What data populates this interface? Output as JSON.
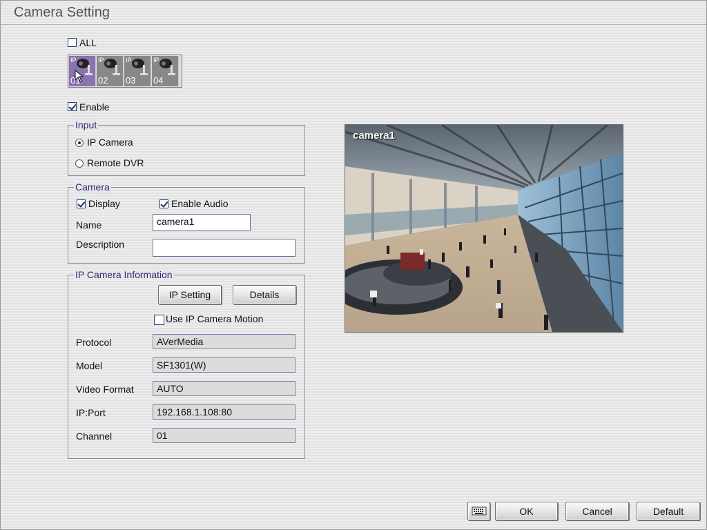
{
  "window": {
    "title": "Camera Setting"
  },
  "selector": {
    "all_label": "ALL",
    "all_checked": false,
    "cameras": [
      {
        "tag": "IP",
        "number": "01",
        "selected": true
      },
      {
        "tag": "IP",
        "number": "02",
        "selected": false
      },
      {
        "tag": "IP",
        "number": "03",
        "selected": false
      },
      {
        "tag": "IP",
        "number": "04",
        "selected": false
      }
    ]
  },
  "enable": {
    "label": "Enable",
    "checked": true
  },
  "input_group": {
    "title": "Input",
    "options": [
      {
        "label": "IP Camera",
        "selected": true
      },
      {
        "label": "Remote DVR",
        "selected": false
      }
    ]
  },
  "camera_group": {
    "title": "Camera",
    "display_label": "Display",
    "display_checked": true,
    "audio_label": "Enable Audio",
    "audio_checked": true,
    "name_label": "Name",
    "name_value": "camera1",
    "description_label": "Description",
    "description_value": ""
  },
  "ip_info": {
    "title": "IP Camera Information",
    "ip_setting_button": "IP Setting",
    "details_button": "Details",
    "motion_label": "Use IP Camera Motion",
    "motion_checked": false,
    "rows": [
      {
        "label": "Protocol",
        "value": "AVerMedia"
      },
      {
        "label": "Model",
        "value": "SF1301(W)"
      },
      {
        "label": "Video Format",
        "value": "AUTO"
      },
      {
        "label": "IP:Port",
        "value": "192.168.1.108:80"
      },
      {
        "label": "Channel",
        "value": "01"
      }
    ]
  },
  "preview": {
    "overlay_label": "camera1"
  },
  "footer": {
    "keyboard_icon": "keyboard-icon",
    "ok": "OK",
    "cancel": "Cancel",
    "default": "Default"
  }
}
